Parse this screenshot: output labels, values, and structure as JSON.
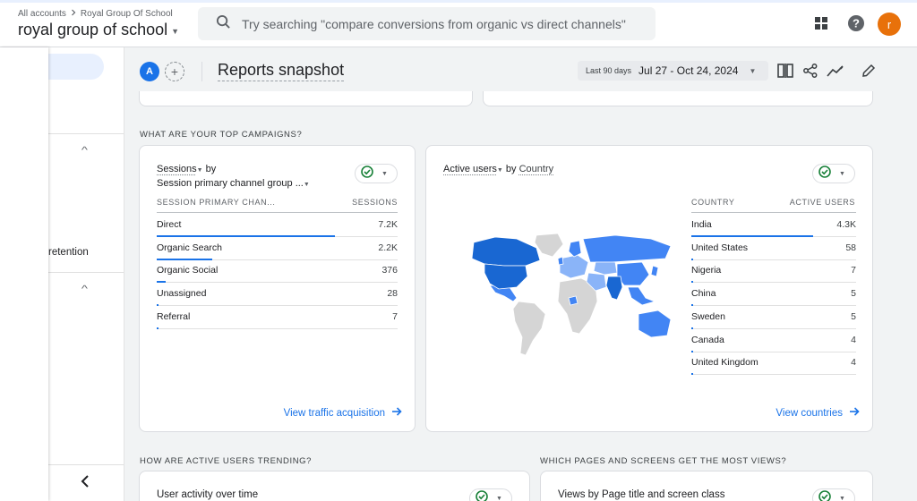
{
  "topbar": {
    "breadcrumb": [
      "All accounts",
      "Royal Group Of School"
    ],
    "account_name": "royal group of school",
    "search_placeholder": "Try searching \"compare conversions from organic vs direct channels\"",
    "user_initial": "r"
  },
  "sidebar": {
    "partial_item": "retention"
  },
  "header": {
    "comparison_badge": "A",
    "title": "Reports snapshot",
    "date_label": "Last 90 days",
    "date_value": "Jul 27 - Oct 24, 2024"
  },
  "campaigns": {
    "section_title": "WHAT ARE YOUR TOP CAMPAIGNS?",
    "metric": "Sessions",
    "by_word": "by",
    "dimension": "Session primary channel group ...",
    "col_dimension": "SESSION PRIMARY CHAN...",
    "col_metric": "SESSIONS",
    "rows": [
      {
        "label": "Direct",
        "value": "7.2K",
        "share": 1.0
      },
      {
        "label": "Organic Search",
        "value": "2.2K",
        "share": 0.31
      },
      {
        "label": "Organic Social",
        "value": "376",
        "share": 0.05
      },
      {
        "label": "Unassigned",
        "value": "28",
        "share": 0.004
      },
      {
        "label": "Referral",
        "value": "7",
        "share": 0.001
      }
    ],
    "link": "View traffic acquisition"
  },
  "countries": {
    "metric": "Active users",
    "by_word": "by",
    "dimension": "Country",
    "col_dimension": "COUNTRY",
    "col_metric": "ACTIVE USERS",
    "rows": [
      {
        "label": "India",
        "value": "4.3K",
        "share": 1.0
      },
      {
        "label": "United States",
        "value": "58",
        "share": 0.013
      },
      {
        "label": "Nigeria",
        "value": "7",
        "share": 0.002
      },
      {
        "label": "China",
        "value": "5",
        "share": 0.001
      },
      {
        "label": "Sweden",
        "value": "5",
        "share": 0.001
      },
      {
        "label": "Canada",
        "value": "4",
        "share": 0.001
      },
      {
        "label": "United Kingdom",
        "value": "4",
        "share": 0.001
      }
    ],
    "link": "View countries",
    "map_colors": {
      "high": "#1967d2",
      "mid": "#4285f4",
      "low": "#8ab4f8",
      "none": "#d5d5d5"
    }
  },
  "trending": {
    "section_title": "HOW ARE ACTIVE USERS TRENDING?",
    "card_title": "User activity over time"
  },
  "pages": {
    "section_title": "WHICH PAGES AND SCREENS GET THE MOST VIEWS?",
    "card_title": "Views by Page title and screen class"
  }
}
